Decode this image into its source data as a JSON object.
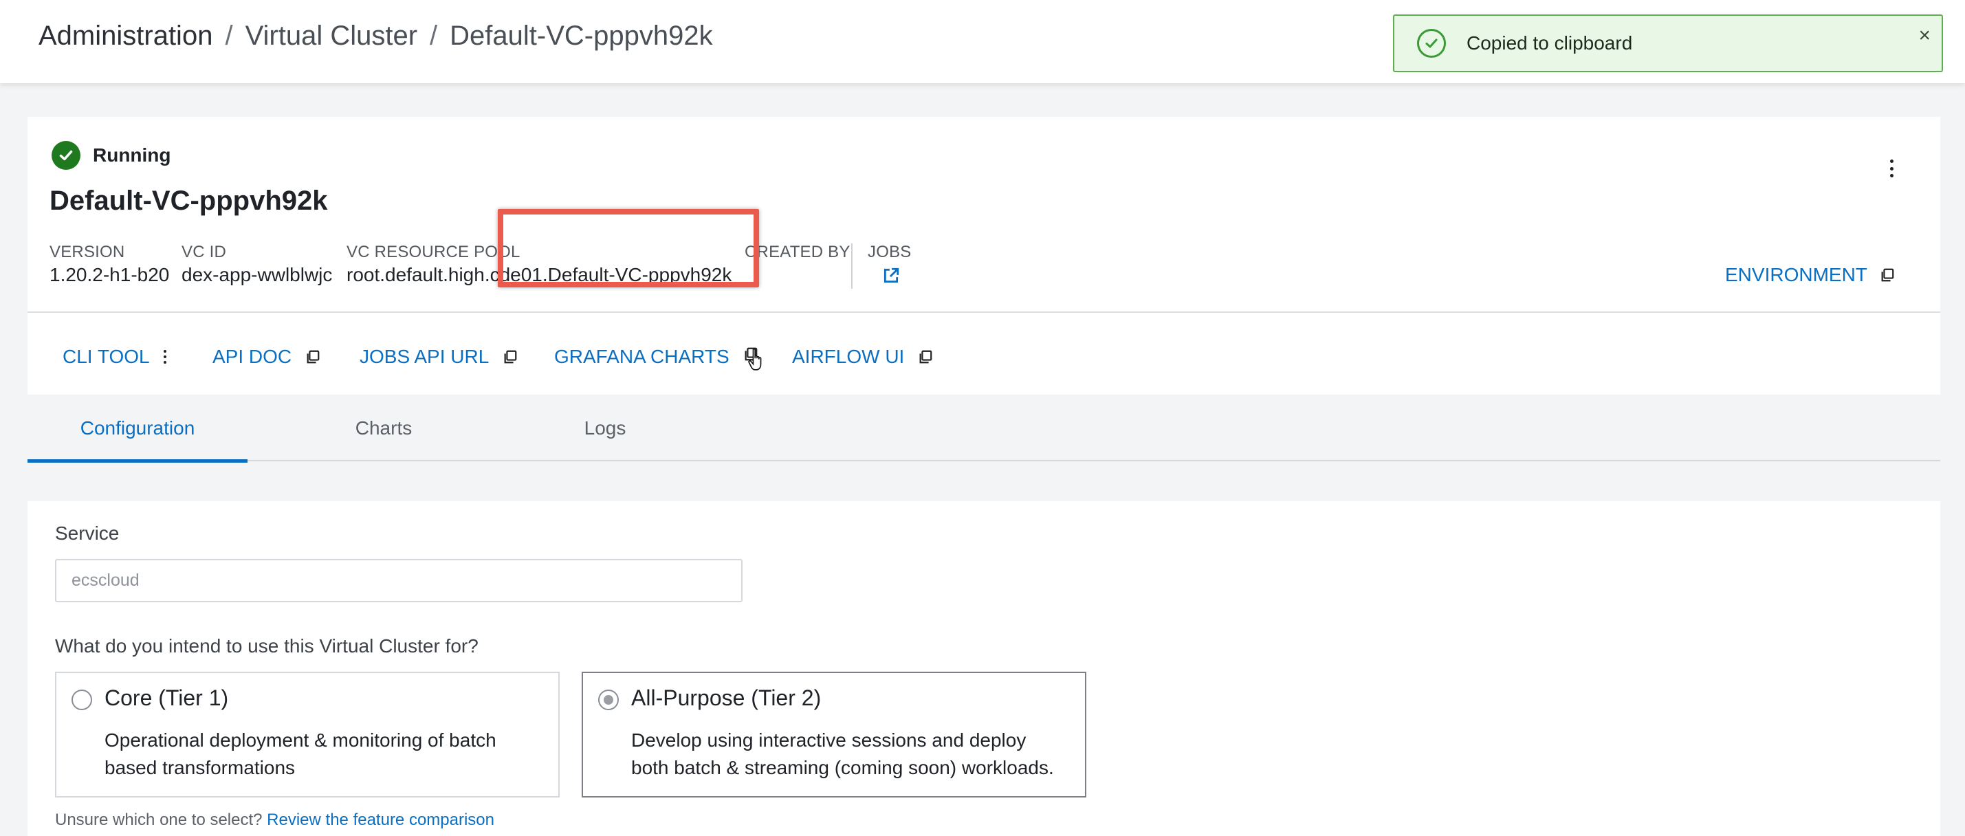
{
  "header": {
    "breadcrumb": [
      "Administration",
      "Virtual Cluster",
      "Default-VC-pppvh92k"
    ],
    "separator": "/"
  },
  "toast": {
    "message": "Copied to clipboard",
    "close_symbol": "×",
    "icon": "check-circle-icon",
    "accent": "#5cae4f"
  },
  "vc": {
    "status": "Running",
    "status_icon": "check-circle-filled-icon",
    "name": "Default-VC-pppvh92k",
    "meta": {
      "version_label": "VERSION",
      "version_value": "1.20.2-h1-b20",
      "vcid_label": "VC ID",
      "vcid_value": "dex-app-wwlblwjc",
      "pool_label": "VC RESOURCE POOL",
      "pool_value": "root.default.high.cde01.Default-VC-pppvh92k",
      "created_label": "CREATED BY",
      "created_value": "",
      "jobs_label": "JOBS"
    },
    "environment_label": "ENVIRONMENT"
  },
  "actions": [
    {
      "label": "CLI TOOL",
      "icon": "more-vertical-icon"
    },
    {
      "label": "API DOC",
      "icon": "copy-icon"
    },
    {
      "label": "JOBS API URL",
      "icon": "copy-icon"
    },
    {
      "label": "GRAFANA CHARTS",
      "icon": "copy-icon"
    },
    {
      "label": "AIRFLOW UI",
      "icon": "copy-icon"
    }
  ],
  "tabs": [
    {
      "label": "Configuration",
      "active": true
    },
    {
      "label": "Charts",
      "active": false
    },
    {
      "label": "Logs",
      "active": false
    }
  ],
  "config": {
    "service_label": "Service",
    "service_value": "ecscloud",
    "question": "What do you intend to use this Virtual Cluster for?",
    "options": [
      {
        "title": "Core (Tier 1)",
        "desc_line1": "Operational deployment & monitoring of batch",
        "desc_line2": "based transformations",
        "selected": false
      },
      {
        "title": "All-Purpose (Tier 2)",
        "desc_line1": "Develop using interactive sessions and deploy",
        "desc_line2": "both batch & streaming (coming soon) workloads.",
        "selected": true
      }
    ],
    "hint_text": "Unsure which one to select?",
    "hint_link": "Review the feature comparison"
  },
  "colors": {
    "link": "#0a6fc2",
    "success": "#1f7a1f",
    "highlight": "#ea5b4d"
  }
}
